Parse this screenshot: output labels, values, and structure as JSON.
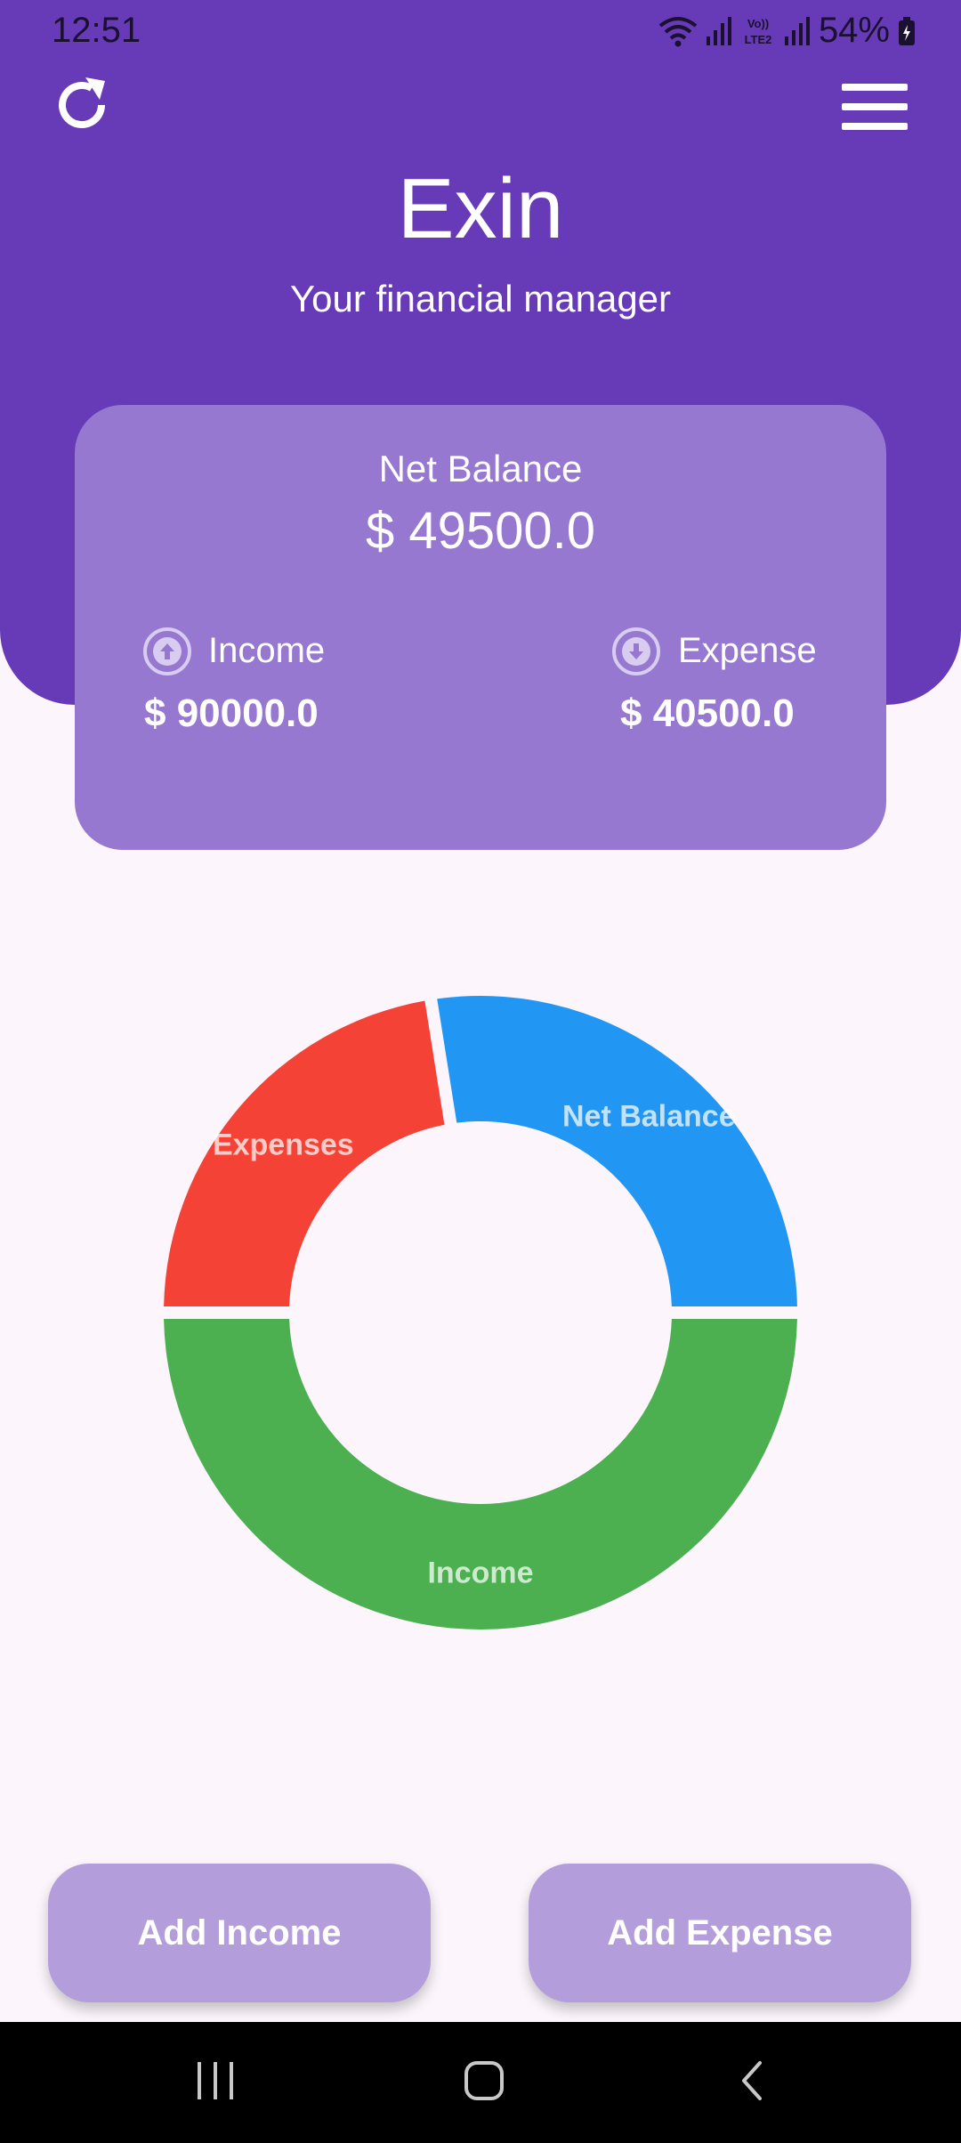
{
  "status_bar": {
    "time": "12:51",
    "battery": "54%",
    "icons": [
      "wifi-icon",
      "signal-icon",
      "volte-icon",
      "signal-icon",
      "battery-icon"
    ]
  },
  "header": {
    "title": "Exin",
    "subtitle": "Your financial manager",
    "refresh_icon": "refresh-icon",
    "menu_icon": "menu-icon",
    "background_color": "#673ab7"
  },
  "balance_card": {
    "net_label": "Net Balance",
    "net_value": "$ 49500.0",
    "income_label": "Income",
    "income_value": "$ 90000.0",
    "expense_label": "Expense",
    "expense_value": "$ 40500.0",
    "card_color": "#9778d0"
  },
  "chart_data": {
    "type": "pie",
    "donut": true,
    "slices": [
      {
        "label": "Net Balance",
        "value": 49500,
        "color": "#2196f3"
      },
      {
        "label": "Expenses",
        "value": 40500,
        "color": "#f44336"
      },
      {
        "label": "Income",
        "value": 90000,
        "color": "#4caf50"
      }
    ]
  },
  "actions": {
    "add_income": "Add Income",
    "add_expense": "Add Expense",
    "button_color": "#b39ddb"
  },
  "nav_bar": {
    "recents_icon": "recents-icon",
    "home_icon": "home-icon",
    "back_icon": "back-icon"
  }
}
